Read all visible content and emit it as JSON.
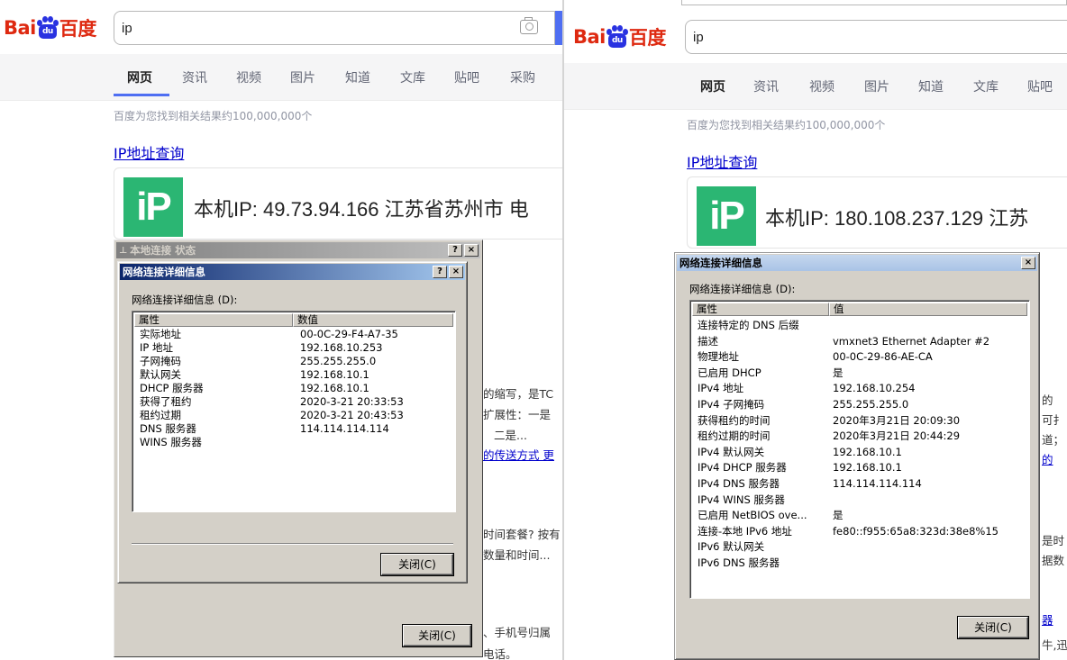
{
  "left": {
    "logo": {
      "bai": "Bai",
      "du": "du",
      "zh": "百度"
    },
    "search": {
      "query": "ip"
    },
    "tabs": [
      "网页",
      "资讯",
      "视频",
      "图片",
      "知道",
      "文库",
      "贴吧",
      "采购"
    ],
    "result_count": "百度为您找到相关结果约100,000,000个",
    "result_title": "IP地址查询",
    "ip_logo": "iP",
    "ip_text": "本机IP: 49.73.94.166 江苏省苏州市 电",
    "snippets": [
      "的缩写，是TC",
      "扩展性：一是",
      "二是...",
      "的传送方式  更",
      "时间套餐? 按有",
      "数量和时间...",
      "、手机号归属",
      "电话。"
    ],
    "back_dialog": {
      "title": "本地连接 状态",
      "close_label": "关闭(C)"
    },
    "dialog": {
      "title": "网络连接详细信息",
      "group_label": "网络连接详细信息 (D):",
      "col_property": "属性",
      "col_value": "数值",
      "rows": [
        {
          "p": "实际地址",
          "v": "00-0C-29-F4-A7-35"
        },
        {
          "p": "IP 地址",
          "v": "192.168.10.253"
        },
        {
          "p": "子网掩码",
          "v": "255.255.255.0"
        },
        {
          "p": "默认网关",
          "v": "192.168.10.1"
        },
        {
          "p": "DHCP 服务器",
          "v": "192.168.10.1"
        },
        {
          "p": "获得了租约",
          "v": "2020-3-21 20:33:53"
        },
        {
          "p": "租约过期",
          "v": "2020-3-21 20:43:53"
        },
        {
          "p": "DNS 服务器",
          "v": "114.114.114.114"
        },
        {
          "p": "WINS 服务器",
          "v": ""
        }
      ],
      "close_label": "关闭(C)"
    }
  },
  "right": {
    "logo": {
      "bai": "Bai",
      "du": "du",
      "zh": "百度"
    },
    "search": {
      "query": "ip"
    },
    "tabs": [
      "网页",
      "资讯",
      "视频",
      "图片",
      "知道",
      "文库",
      "贴吧"
    ],
    "result_count": "百度为您找到相关结果约100,000,000个",
    "result_title": "IP地址查询",
    "ip_logo": "iP",
    "ip_text": "本机IP: 180.108.237.129 江苏",
    "snippets": [
      "的",
      "可扌",
      "道；",
      "的",
      "是时",
      "据数",
      "器",
      "牛,迅"
    ],
    "dialog": {
      "title": "网络连接详细信息",
      "group_label": "网络连接详细信息 (D):",
      "col_property": "属性",
      "col_value": "值",
      "rows": [
        {
          "p": "连接特定的 DNS 后缀",
          "v": ""
        },
        {
          "p": "描述",
          "v": "vmxnet3 Ethernet Adapter #2"
        },
        {
          "p": "物理地址",
          "v": "00-0C-29-86-AE-CA"
        },
        {
          "p": "已启用 DHCP",
          "v": "是"
        },
        {
          "p": "IPv4 地址",
          "v": "192.168.10.254"
        },
        {
          "p": "IPv4 子网掩码",
          "v": "255.255.255.0"
        },
        {
          "p": "获得租约的时间",
          "v": "2020年3月21日 20:09:30"
        },
        {
          "p": "租约过期的时间",
          "v": "2020年3月21日 20:44:29"
        },
        {
          "p": "IPv4 默认网关",
          "v": "192.168.10.1"
        },
        {
          "p": "IPv4 DHCP 服务器",
          "v": "192.168.10.1"
        },
        {
          "p": "IPv4 DNS 服务器",
          "v": "114.114.114.114"
        },
        {
          "p": "IPv4 WINS 服务器",
          "v": ""
        },
        {
          "p": "已启用 NetBIOS ove...",
          "v": "是"
        },
        {
          "p": "连接-本地 IPv6 地址",
          "v": "fe80::f955:65a8:323d:38e8%15"
        },
        {
          "p": "IPv6 默认网关",
          "v": ""
        },
        {
          "p": "IPv6 DNS 服务器",
          "v": ""
        }
      ],
      "close_label": "关闭(C)"
    }
  }
}
